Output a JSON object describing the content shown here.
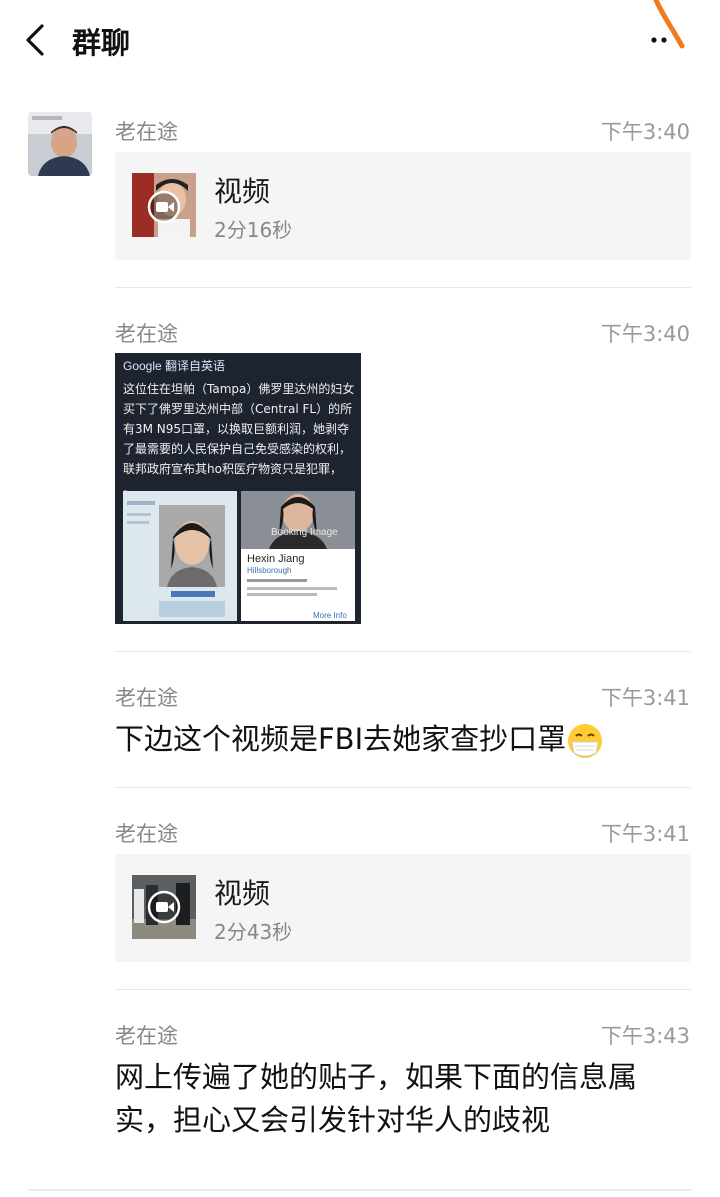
{
  "header": {
    "title": "群聊"
  },
  "messages": [
    {
      "sender": "老在途",
      "time": "下午3:40",
      "type": "video",
      "title": "视频",
      "duration": "2分16秒"
    },
    {
      "sender": "老在途",
      "time": "下午3:40",
      "type": "image",
      "image": {
        "header": "Google 翻译自英语",
        "text": "这位住在坦帕（Tampa）佛罗里达州的妇女买下了佛罗里达州中部（Central FL）的所有3M N95口罩，以换取巨额利润，她剥夺了最需要的人民保护自己免受感染的权利，联邦政府宣布其ho积医疗物资只是犯罪， 。",
        "name": "Hexin Jiang",
        "location": "Hillsborough",
        "watermark": "Booking Image",
        "link": "More Info"
      }
    },
    {
      "sender": "老在途",
      "time": "下午3:41",
      "type": "text",
      "text": "下边这个视频是FBI去她家查抄口罩",
      "emoji": "mask-face"
    },
    {
      "sender": "老在途",
      "time": "下午3:41",
      "type": "video",
      "title": "视频",
      "duration": "2分43秒"
    },
    {
      "sender": "老在途",
      "time": "下午3:43",
      "type": "text",
      "text": "网上传遍了她的贴子，如果下面的信息属实，担心又会引发针对华人的歧视"
    }
  ],
  "colors": {
    "card_bg": "#f5f5f5",
    "meta_text": "#888888",
    "pen_mark": "#f07a1e"
  }
}
